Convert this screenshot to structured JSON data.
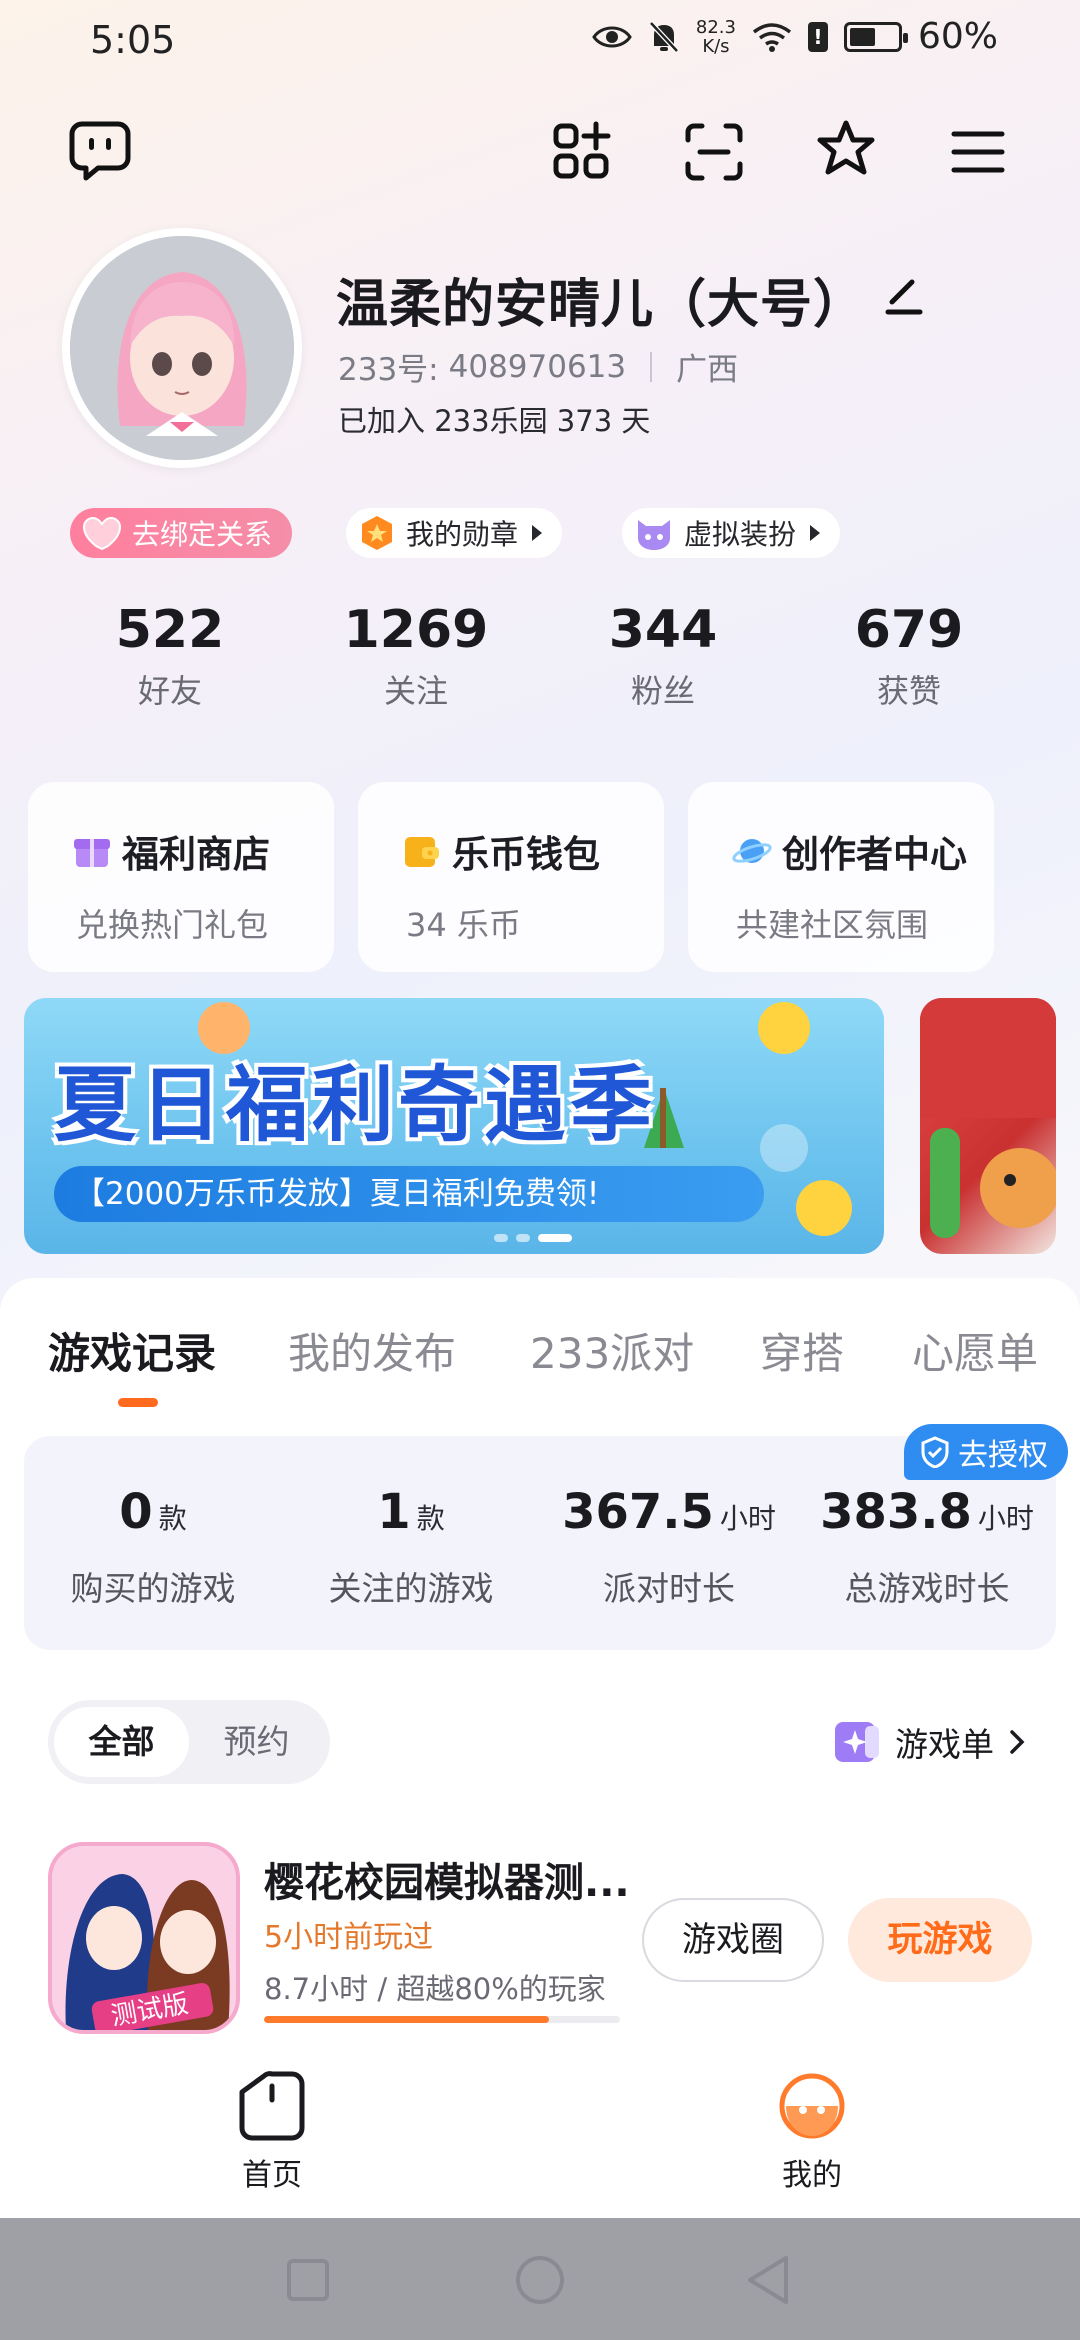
{
  "status_bar": {
    "time": "5:05",
    "net_speed_value": "82.3",
    "net_speed_unit": "K/s",
    "battery": "60%",
    "battery_level": 0.6
  },
  "toolbar": {
    "icons": [
      "chat-bubble-icon",
      "add-app-icon",
      "scan-icon",
      "star-badge-icon",
      "menu-icon"
    ]
  },
  "profile": {
    "nickname": "温柔的安晴儿（大号）",
    "uid_label": "233号:",
    "uid_value": "408970613",
    "location": "广西",
    "joined": "已加入 233乐园 373 天"
  },
  "chips": {
    "bind": "去绑定关系",
    "medal": "我的勋章",
    "avatar": "虚拟装扮"
  },
  "stats": [
    {
      "value": "522",
      "label": "好友"
    },
    {
      "value": "1269",
      "label": "关注"
    },
    {
      "value": "344",
      "label": "粉丝"
    },
    {
      "value": "679",
      "label": "获赞"
    }
  ],
  "cards": [
    {
      "title": "福利商店",
      "subtitle": "兑换热门礼包",
      "color": "#a36cf0"
    },
    {
      "title": "乐币钱包",
      "subtitle": "34 乐币",
      "color": "#f7b21b"
    },
    {
      "title": "创作者中心",
      "subtitle": "共建社区氛围",
      "color": "#4aa0f5"
    }
  ],
  "banner": {
    "title": "夏日福利奇遇季",
    "subtitle": "【2000万乐币发放】夏日福利免费领!"
  },
  "tabs": [
    "游戏记录",
    "我的发布",
    "233派对",
    "穿搭",
    "心愿单"
  ],
  "auth_badge": "去授权",
  "summary": [
    {
      "value": "0",
      "unit": "款",
      "label": "购买的游戏"
    },
    {
      "value": "1",
      "unit": "款",
      "label": "关注的游戏"
    },
    {
      "value": "367.5",
      "unit": "小时",
      "label": "派对时长"
    },
    {
      "value": "383.8",
      "unit": "小时",
      "label": "总游戏时长"
    }
  ],
  "filters": [
    "全部",
    "预约"
  ],
  "game_list_link": "游戏单",
  "game": {
    "title": "樱花校园模拟器测...",
    "played": "5小时前玩过",
    "time_stats": "8.7小时 / 超越80%的玩家",
    "progress": 0.8,
    "icon_badge": "测试版",
    "circle_button": "游戏圈",
    "play_button": "玩游戏"
  },
  "bottom_nav": {
    "home": "首页",
    "mine": "我的"
  },
  "colors": {
    "accent": "#ff6a1f",
    "auth_blue": "#2f8cf0",
    "bind_pink": "#ff7f9e"
  }
}
